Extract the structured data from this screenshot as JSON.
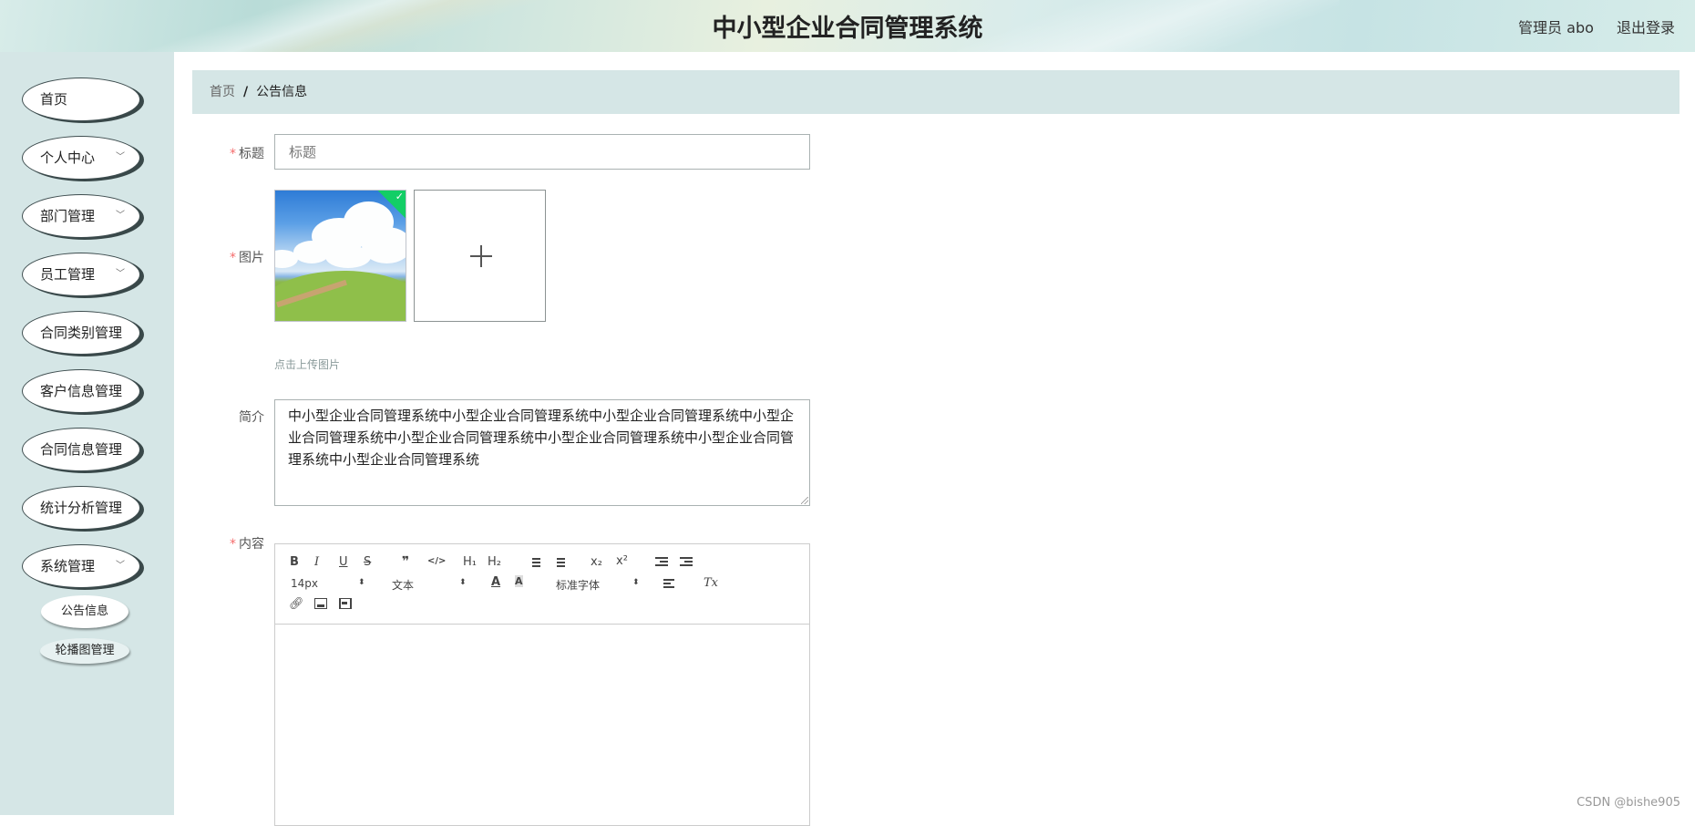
{
  "header": {
    "title": "中小型企业合同管理系统",
    "user_label": "管理员 abo",
    "logout_label": "退出登录"
  },
  "sidebar": {
    "items": [
      {
        "label": "首页",
        "has_arrow": false
      },
      {
        "label": "个人中心",
        "has_arrow": true
      },
      {
        "label": "部门管理",
        "has_arrow": true
      },
      {
        "label": "员工管理",
        "has_arrow": true
      },
      {
        "label": "合同类别管理",
        "has_arrow": false
      },
      {
        "label": "客户信息管理",
        "has_arrow": false
      },
      {
        "label": "合同信息管理",
        "has_arrow": false
      },
      {
        "label": "统计分析管理",
        "has_arrow": false
      },
      {
        "label": "系统管理",
        "has_arrow": true
      }
    ],
    "sub_items": [
      "公告信息",
      "轮播图管理"
    ]
  },
  "breadcrumb": {
    "home": "首页",
    "separator": "/",
    "current": "公告信息"
  },
  "form": {
    "required_mark": "*",
    "title_label": "标题",
    "title_placeholder": "标题",
    "title_value": "",
    "image_label": "图片",
    "upload_tip": "点击上传图片",
    "intro_label": "简介",
    "intro_value": "中小型企业合同管理系统中小型企业合同管理系统中小型企业合同管理系统中小型企业合同管理系统中小型企业合同管理系统中小型企业合同管理系统中小型企业合同管理系统中小型企业合同管理系统",
    "content_label": "内容"
  },
  "editor": {
    "toolbar": {
      "bold": "B",
      "italic": "I",
      "underline": "U",
      "strike": "S",
      "quote": "❞",
      "code": "</>",
      "h1": "H₁",
      "h2": "H₂",
      "subscript": "x₂",
      "superscript": "x²",
      "size_value": "14px",
      "header_value": "文本",
      "font_value": "标准字体",
      "clean": "Tx"
    },
    "content": ""
  },
  "watermark": "CSDN @bishe905",
  "colors": {
    "sidebar_bg": "#d5e6e6",
    "required": "#f56c6c",
    "success_badge": "#13ce66"
  }
}
